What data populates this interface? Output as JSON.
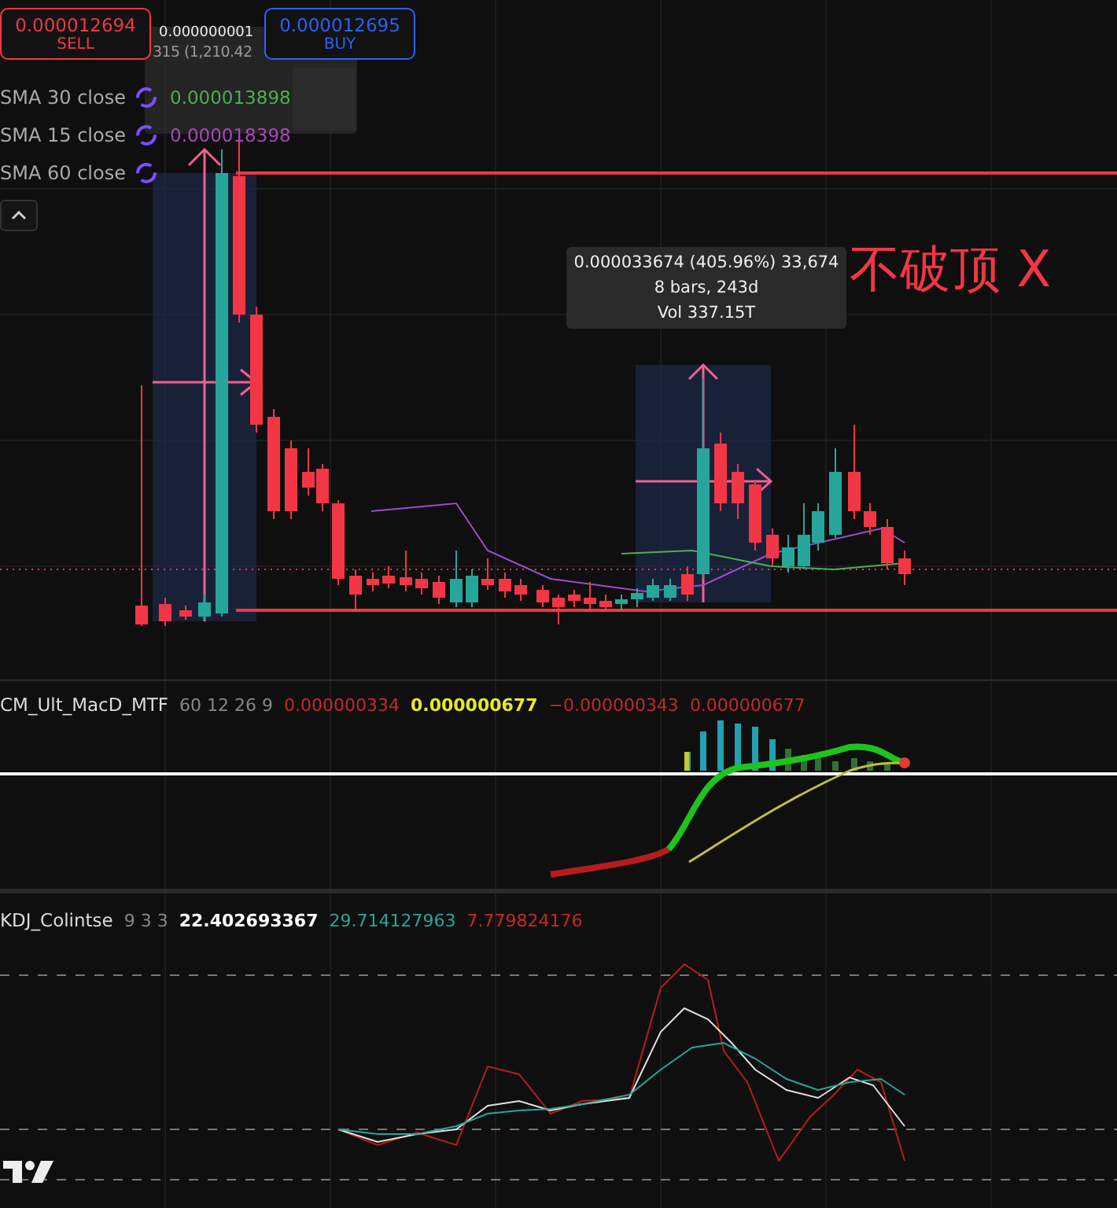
{
  "trade_buttons": [
    {
      "kind": "sell",
      "price": "0.000012694",
      "label": "SELL"
    },
    {
      "kind": "buy",
      "price": "0.000012695",
      "label": "BUY"
    }
  ],
  "price_scale_tag": "0.000000001",
  "faded_measure": {
    "lines": [
      "315 (1,210.42"
    ]
  },
  "indicators": [
    {
      "name": "SMA 30 close",
      "value": "0.000013898",
      "color": "#4caf50"
    },
    {
      "name": "SMA 15 close",
      "value": "0.000018398",
      "color": "#ab47bc"
    },
    {
      "name": "SMA 60 close"
    }
  ],
  "measure_tooltip": {
    "lines": [
      "0.000033674 (405.96%) 33,674",
      "8 bars, 243d",
      "Vol 337.15T"
    ]
  },
  "annotation": "不破顶 X",
  "macd_legend": {
    "name": "CM_Ult_MacD_MTF",
    "params": "60 12 26 9",
    "values": [
      {
        "text": "0.000000334",
        "color": "#c62828"
      },
      {
        "text": "0.000000677",
        "color": "#e8e82a"
      },
      {
        "text": "−0.000000343",
        "color": "#c62828"
      },
      {
        "text": "0.000000677",
        "color": "#c62828"
      }
    ]
  },
  "kdj_legend": {
    "name": "KDJ_Colintse",
    "params": "9 3 3",
    "values": [
      {
        "text": "22.402693367",
        "color": "#ffffff"
      },
      {
        "text": "29.714127963",
        "color": "#26a69a"
      },
      {
        "text": "7.779824176",
        "color": "#c62828"
      }
    ]
  }
}
